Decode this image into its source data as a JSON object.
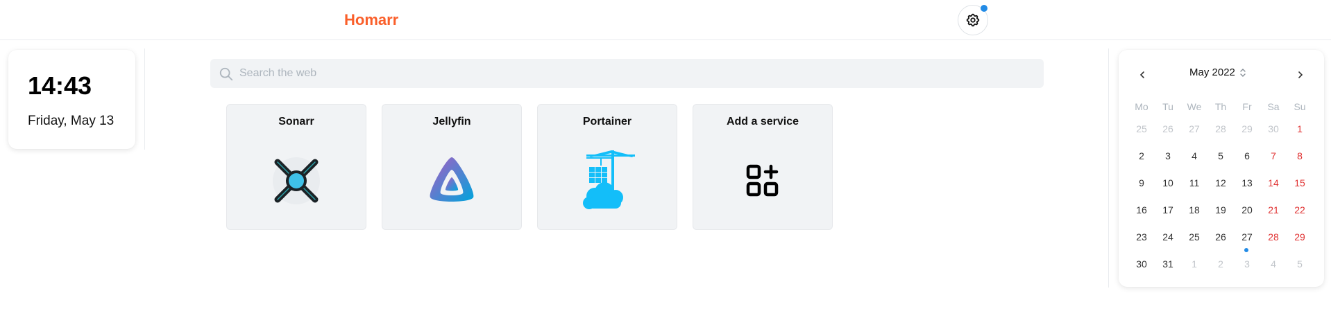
{
  "header": {
    "brand": "Homarr"
  },
  "clock": {
    "time": "14:43",
    "date": "Friday, May 13"
  },
  "search": {
    "placeholder": "Search the web",
    "value": ""
  },
  "services": [
    {
      "name": "Sonarr",
      "icon": "sonarr-logo"
    },
    {
      "name": "Jellyfin",
      "icon": "jellyfin-logo"
    },
    {
      "name": "Portainer",
      "icon": "portainer-logo"
    },
    {
      "name": "Add a service",
      "icon": "add-apps-icon"
    }
  ],
  "calendar": {
    "month_label": "May 2022",
    "weekdays": [
      "Mo",
      "Tu",
      "We",
      "Th",
      "Fr",
      "Sa",
      "Su"
    ],
    "weeks": [
      [
        "25",
        "26",
        "27",
        "28",
        "29",
        "30",
        "1"
      ],
      [
        "2",
        "3",
        "4",
        "5",
        "6",
        "7",
        "8"
      ],
      [
        "9",
        "10",
        "11",
        "12",
        "13",
        "14",
        "15"
      ],
      [
        "16",
        "17",
        "18",
        "19",
        "20",
        "21",
        "22"
      ],
      [
        "23",
        "24",
        "25",
        "26",
        "27",
        "28",
        "29"
      ],
      [
        "30",
        "31",
        "1",
        "2",
        "3",
        "4",
        "5"
      ]
    ]
  },
  "colors": {
    "brand": "#fa5f2a",
    "accent": "#228be6",
    "weekend": "#e03131"
  }
}
